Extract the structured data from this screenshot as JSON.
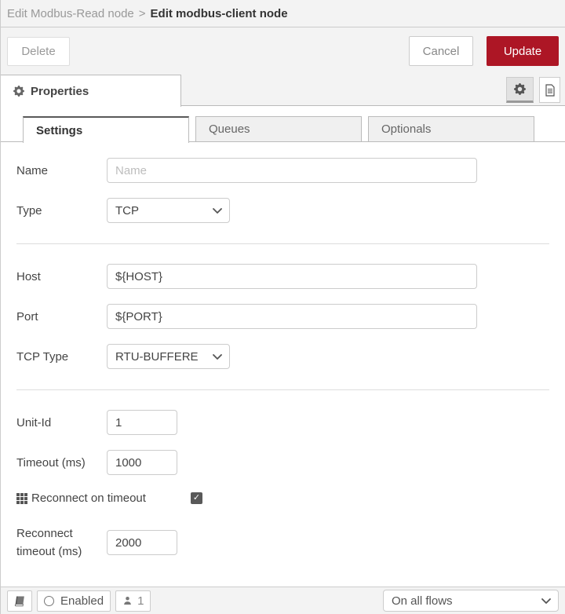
{
  "header": {
    "breadcrumb_parent": "Edit Modbus-Read node",
    "breadcrumb_separator": ">",
    "breadcrumb_current": "Edit modbus-client node"
  },
  "toolbar": {
    "delete_label": "Delete",
    "cancel_label": "Cancel",
    "update_label": "Update"
  },
  "panel": {
    "properties_tab_label": "Properties"
  },
  "tabs": [
    {
      "label": "Settings",
      "active": true
    },
    {
      "label": "Queues",
      "active": false
    },
    {
      "label": "Optionals",
      "active": false
    }
  ],
  "form": {
    "name": {
      "label": "Name",
      "placeholder": "Name",
      "value": ""
    },
    "type": {
      "label": "Type",
      "value": "TCP"
    },
    "host": {
      "label": "Host",
      "value": "${HOST}"
    },
    "port": {
      "label": "Port",
      "value": "${PORT}"
    },
    "tcp_type": {
      "label": "TCP Type",
      "value": "RTU-BUFFERED"
    },
    "unit_id": {
      "label": "Unit-Id",
      "value": "1"
    },
    "timeout": {
      "label": "Timeout (ms)",
      "value": "1000"
    },
    "reconnect_on_timeout": {
      "label": "Reconnect on timeout",
      "checked": true
    },
    "reconnect_timeout": {
      "label_line1": "Reconnect",
      "label_line2": "timeout (ms)",
      "value": "2000"
    }
  },
  "footer": {
    "enabled_label": "Enabled",
    "instance_count": "1",
    "scope_value": "On all flows"
  },
  "icons": {
    "check": "✓"
  },
  "colors": {
    "accent_red": "#AD1625",
    "bar_bg": "#f3f3f3",
    "border": "#cccccc",
    "checkbox_fill": "#595959"
  }
}
